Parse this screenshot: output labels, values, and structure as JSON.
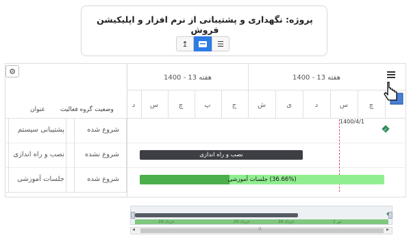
{
  "project": {
    "title": "پروژه: نگهداری و پشتیبانی از نرم افزار و اپلیکیشن فروش",
    "view_buttons": [
      {
        "name": "export",
        "icon": "arrow-up-icon",
        "glyph": "↥"
      },
      {
        "name": "gantt",
        "icon": "gantt-icon",
        "glyph": "▬",
        "active": true
      },
      {
        "name": "list",
        "icon": "list-icon",
        "glyph": "☰"
      }
    ]
  },
  "grid": {
    "settings_icon": "gear-icon",
    "headers": {
      "status": "وضعیت",
      "group": "گروه فعالیت",
      "title": "عنوان"
    },
    "rows": [
      {
        "title": "پشتیبانی سیستم",
        "status": "شروع شده"
      },
      {
        "title": "نصب و راه اندازی",
        "status": "شروع نشده"
      },
      {
        "title": "جلسات آموزشی",
        "status": "شروع شده"
      }
    ]
  },
  "timeline": {
    "weeks": [
      "هفته 13 - 1400",
      "هفته 13 - 1400"
    ],
    "days": [
      "چ",
      "س",
      "د",
      "ی",
      "ش",
      "ج",
      "پ",
      "چ",
      "س",
      "د"
    ],
    "today_label": "1400/4/1",
    "menu_icon": "hamburger-icon",
    "bars": [
      {
        "label": "نصب و راه اندازی",
        "color": "#3d3f44"
      },
      {
        "label": "(36.66%) جلسات آموزشی",
        "progress_percent": 36.66,
        "done_color": "#4cae4c",
        "rest_color": "#90ee90"
      }
    ]
  },
  "minimap": {
    "months": [
      "تیر 1",
      "خرداد 26",
      "خرداد 20",
      "خرداد 26"
    ]
  },
  "colors": {
    "accent": "#2d7be5",
    "milestone": "#2e8b57"
  }
}
